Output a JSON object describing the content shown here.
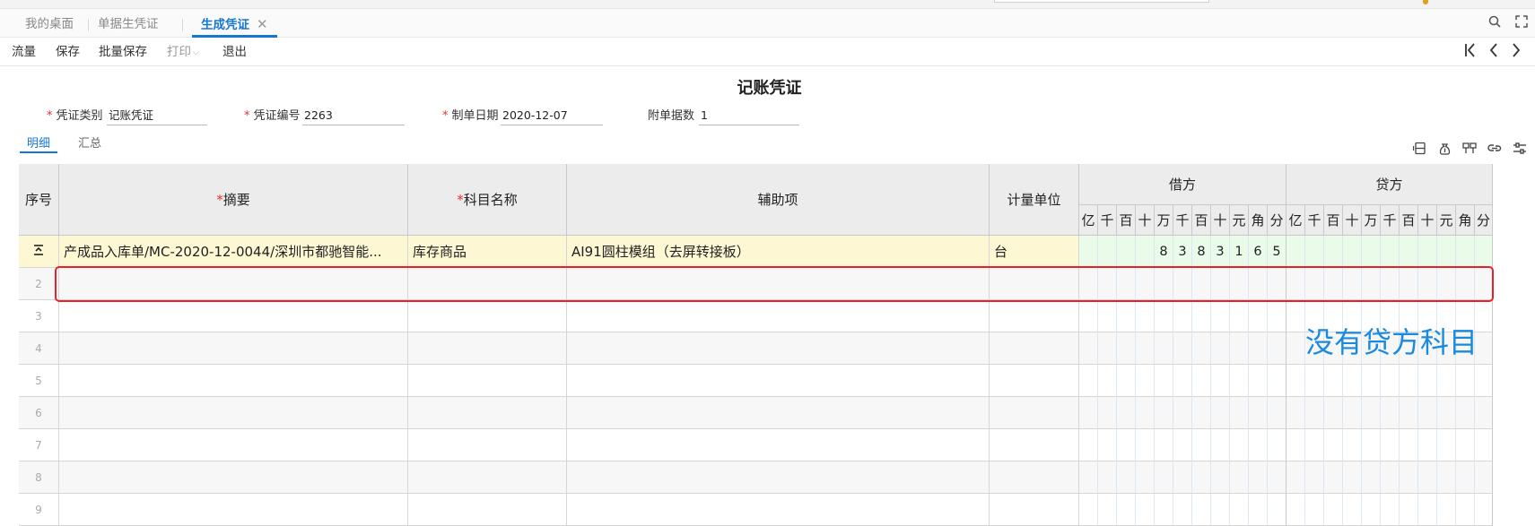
{
  "window": {
    "tabs": [
      {
        "label": "我的桌面",
        "active": false
      },
      {
        "label": "单据生凭证",
        "active": false
      },
      {
        "label": "生成凭证",
        "active": true,
        "closable": true
      }
    ],
    "close_symbol": "✕",
    "icons": [
      "search-icon",
      "fullscreen-icon"
    ]
  },
  "toolbar": {
    "buttons": [
      {
        "label": "流量",
        "enabled": true
      },
      {
        "label": "保存",
        "enabled": true
      },
      {
        "label": "批量保存",
        "enabled": true
      },
      {
        "label": "打印",
        "enabled": false,
        "has_dropdown": true
      },
      {
        "label": "退出",
        "enabled": true
      }
    ],
    "nav_icons": [
      "first-page-icon",
      "prev-page-icon",
      "next-page-icon"
    ]
  },
  "voucher": {
    "title": "记账凭证",
    "fields": [
      {
        "label": "凭证类别",
        "value": "记账凭证",
        "required": true
      },
      {
        "label": "凭证编号",
        "value": "2263",
        "required": true
      },
      {
        "label": "制单日期",
        "value": "2020-12-07",
        "required": true
      },
      {
        "label": "附单据数",
        "value": "1",
        "required": false
      }
    ],
    "required_mark": "*",
    "subtabs": [
      {
        "label": "明细",
        "active": true
      },
      {
        "label": "汇总",
        "active": false
      }
    ],
    "right_icons": [
      "insert-row-icon",
      "money-bag-icon",
      "layout-icon",
      "link-icon",
      "settings-icon"
    ]
  },
  "grid": {
    "headers": {
      "seq": "序号",
      "summary": "摘要",
      "account": "科目名称",
      "auxiliary": "辅助项",
      "unit": "计量单位",
      "debit": "借方",
      "credit": "贷方"
    },
    "digit_units": [
      "亿",
      "千",
      "百",
      "十",
      "万",
      "千",
      "百",
      "十",
      "元",
      "角",
      "分"
    ],
    "rows": [
      {
        "seq": "",
        "seq_icon": "row-handle-icon",
        "summary": "产成品入库单/MC-2020-12-0044/深圳市都驰智能...",
        "account": "库存商品",
        "auxiliary": "AI91圆柱模组（去屏转接板）",
        "unit": "台",
        "debit_digits": [
          "",
          "",
          "",
          "",
          "8",
          "3",
          "8",
          "3",
          "1",
          "6",
          "5"
        ],
        "credit_digits": [
          "",
          "",
          "",
          "",
          "",
          "",
          "",
          "",
          "",
          "",
          ""
        ]
      },
      {
        "seq": "2",
        "summary": "",
        "account": "",
        "auxiliary": "",
        "unit": "",
        "debit_digits": [
          "",
          "",
          "",
          "",
          "",
          "",
          "",
          "",
          "",
          "",
          ""
        ],
        "credit_digits": [
          "",
          "",
          "",
          "",
          "",
          "",
          "",
          "",
          "",
          "",
          ""
        ]
      },
      {
        "seq": "3",
        "summary": "",
        "account": "",
        "auxiliary": "",
        "unit": "",
        "debit_digits": [
          "",
          "",
          "",
          "",
          "",
          "",
          "",
          "",
          "",
          "",
          ""
        ],
        "credit_digits": [
          "",
          "",
          "",
          "",
          "",
          "",
          "",
          "",
          "",
          "",
          ""
        ]
      },
      {
        "seq": "4",
        "summary": "",
        "account": "",
        "auxiliary": "",
        "unit": "",
        "debit_digits": [
          "",
          "",
          "",
          "",
          "",
          "",
          "",
          "",
          "",
          "",
          ""
        ],
        "credit_digits": [
          "",
          "",
          "",
          "",
          "",
          "",
          "",
          "",
          "",
          "",
          ""
        ]
      },
      {
        "seq": "5",
        "summary": "",
        "account": "",
        "auxiliary": "",
        "unit": "",
        "debit_digits": [
          "",
          "",
          "",
          "",
          "",
          "",
          "",
          "",
          "",
          "",
          ""
        ],
        "credit_digits": [
          "",
          "",
          "",
          "",
          "",
          "",
          "",
          "",
          "",
          "",
          ""
        ]
      },
      {
        "seq": "6",
        "summary": "",
        "account": "",
        "auxiliary": "",
        "unit": "",
        "debit_digits": [
          "",
          "",
          "",
          "",
          "",
          "",
          "",
          "",
          "",
          "",
          ""
        ],
        "credit_digits": [
          "",
          "",
          "",
          "",
          "",
          "",
          "",
          "",
          "",
          "",
          ""
        ]
      },
      {
        "seq": "7",
        "summary": "",
        "account": "",
        "auxiliary": "",
        "unit": "",
        "debit_digits": [
          "",
          "",
          "",
          "",
          "",
          "",
          "",
          "",
          "",
          "",
          ""
        ],
        "credit_digits": [
          "",
          "",
          "",
          "",
          "",
          "",
          "",
          "",
          "",
          "",
          ""
        ]
      },
      {
        "seq": "8",
        "summary": "",
        "account": "",
        "auxiliary": "",
        "unit": "",
        "debit_digits": [
          "",
          "",
          "",
          "",
          "",
          "",
          "",
          "",
          "",
          "",
          ""
        ],
        "credit_digits": [
          "",
          "",
          "",
          "",
          "",
          "",
          "",
          "",
          "",
          "",
          ""
        ]
      },
      {
        "seq": "9",
        "summary": "",
        "account": "",
        "auxiliary": "",
        "unit": "",
        "debit_digits": [
          "",
          "",
          "",
          "",
          "",
          "",
          "",
          "",
          "",
          "",
          ""
        ],
        "credit_digits": [
          "",
          "",
          "",
          "",
          "",
          "",
          "",
          "",
          "",
          "",
          ""
        ]
      }
    ]
  },
  "annotation": {
    "text": "没有贷方科目",
    "color": "#1a8ae0",
    "box_color": "#e8202a"
  }
}
